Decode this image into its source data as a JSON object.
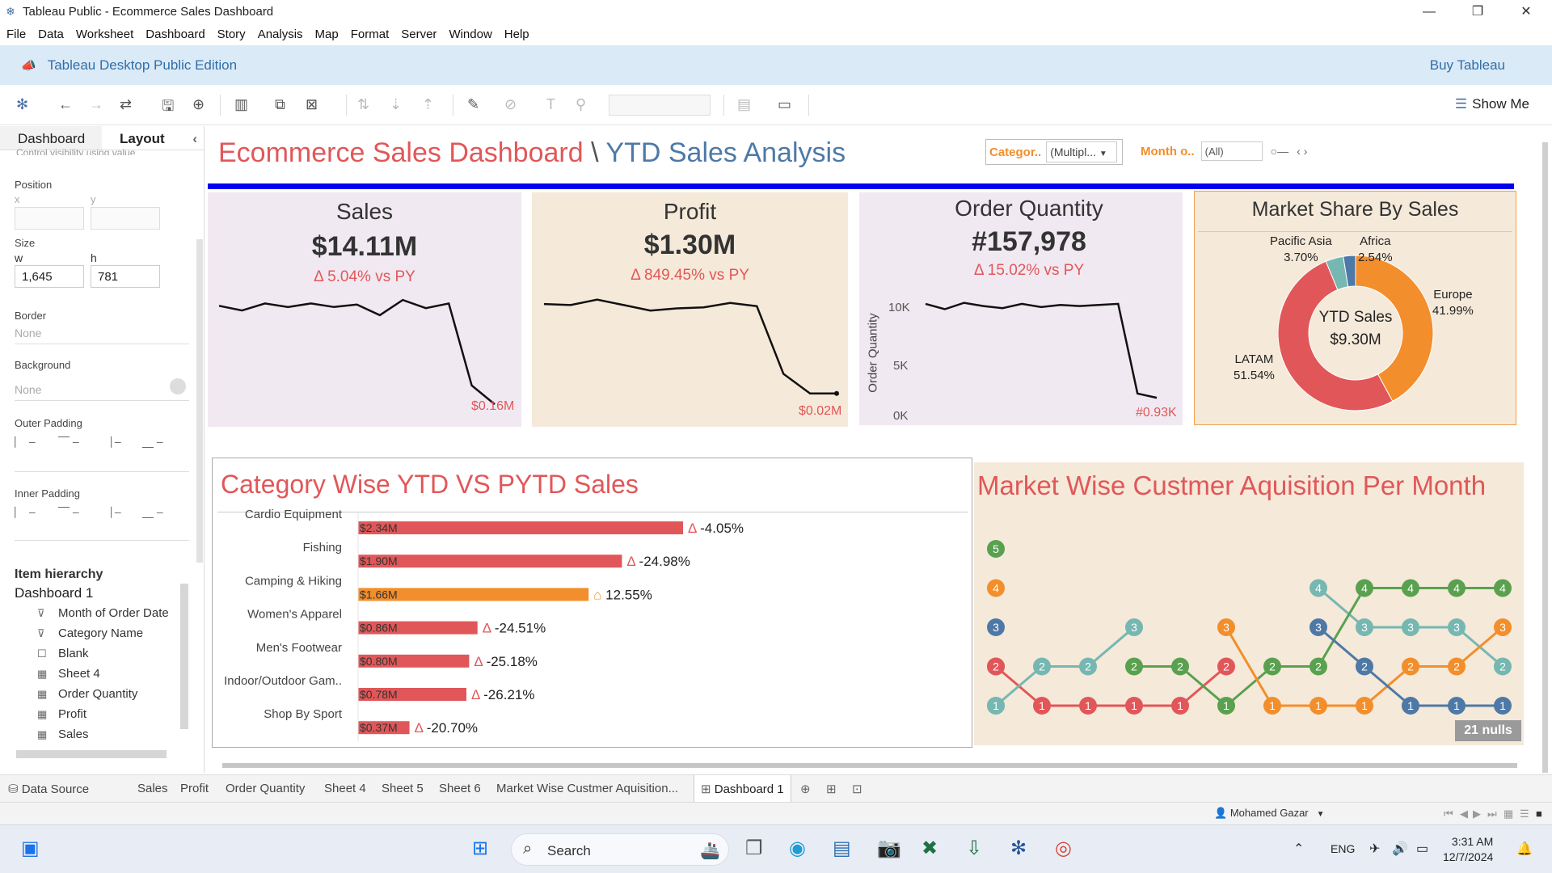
{
  "window": {
    "title": "Tableau Public - Ecommerce Sales Dashboard",
    "minimize": "—",
    "restore": "❐",
    "close": "✕"
  },
  "menu": [
    "File",
    "Data",
    "Worksheet",
    "Dashboard",
    "Story",
    "Analysis",
    "Map",
    "Format",
    "Server",
    "Window",
    "Help"
  ],
  "banner": {
    "edition": "Tableau Desktop Public Edition",
    "buy": "Buy Tableau"
  },
  "toolbar": {
    "show_me": "Show Me"
  },
  "left_pane": {
    "tabs": [
      "Dashboard",
      "Layout"
    ],
    "cut_text": "Control visibility using value",
    "position_label": "Position",
    "x_label": "x",
    "y_label": "y",
    "size_label": "Size",
    "w_label": "w",
    "h_label": "h",
    "w_value": "1,645",
    "h_value": "781",
    "border_label": "Border",
    "border_value": "None",
    "background_label": "Background",
    "background_value": "None",
    "outer_padding_label": "Outer Padding",
    "inner_padding_label": "Inner Padding",
    "hierarchy_title": "Item hierarchy",
    "hierarchy_root": "Dashboard 1",
    "hierarchy_items": [
      {
        "icon": "filter-icon",
        "glyph": "⊽",
        "label": "Month of Order Date"
      },
      {
        "icon": "filter-icon",
        "glyph": "⊽",
        "label": "Category Name"
      },
      {
        "icon": "blank-icon",
        "glyph": "☐",
        "label": "Blank"
      },
      {
        "icon": "sheet-icon",
        "glyph": "▦",
        "label": "Sheet 4"
      },
      {
        "icon": "sheet-icon",
        "glyph": "▦",
        "label": "Order Quantity"
      },
      {
        "icon": "sheet-icon",
        "glyph": "▦",
        "label": "Profit"
      },
      {
        "icon": "sheet-icon",
        "glyph": "▦",
        "label": "Sales"
      }
    ]
  },
  "dashboard": {
    "title_main": "Ecommerce Sales Dashboard",
    "title_sep": "\\",
    "title_sub": "YTD Sales Analysis",
    "filter_category_label": "Categor..",
    "filter_category_value": "(Multipl...",
    "filter_month_label": "Month o..",
    "filter_month_value": "(All)",
    "colors": {
      "red": "#e15759",
      "orange": "#f28e2b",
      "blue": "#4e79a7",
      "green": "#59a14f",
      "teal": "#76b7b2"
    }
  },
  "kpis": {
    "sales": {
      "title": "Sales",
      "value": "$14.11M",
      "delta": "Δ 5.04% vs PY",
      "end_label": "$0.16M",
      "line": [
        0.14,
        0.18,
        0.12,
        0.15,
        0.12,
        0.15,
        0.13,
        0.22,
        0.09,
        0.16,
        0.12,
        0.82,
        0.98
      ]
    },
    "profit": {
      "title": "Profit",
      "value": "$1.30M",
      "delta": "Δ 849.45% vs PY",
      "end_label": "$0.02M",
      "line": [
        0.06,
        0.07,
        0.02,
        0.07,
        0.12,
        0.1,
        0.09,
        0.05,
        0.08,
        0.7,
        0.88,
        0.88
      ]
    },
    "orders": {
      "title": "Order Quantity",
      "value": "#157,978",
      "delta": "Δ 15.02% vs PY",
      "end_label": "#0.93K",
      "y_axis_label": "Order Quantity",
      "y_ticks": [
        "10K",
        "5K",
        "0K"
      ],
      "line": [
        0.06,
        0.11,
        0.05,
        0.08,
        0.1,
        0.06,
        0.09,
        0.07,
        0.08,
        0.07,
        0.06,
        0.9,
        0.94
      ]
    }
  },
  "market_share": {
    "title": "Market Share By Sales",
    "center_label": "YTD Sales",
    "center_value": "$9.30M",
    "slices": [
      {
        "name": "Europe",
        "pct": "41.99%",
        "value": 41.99,
        "color": "#f28e2b"
      },
      {
        "name": "LATAM",
        "pct": "51.54%",
        "value": 51.54,
        "color": "#e15759"
      },
      {
        "name": "Pacific Asia",
        "pct": "3.70%",
        "value": 3.7,
        "color": "#76b7b2"
      },
      {
        "name": "Africa",
        "pct": "2.54%",
        "value": 2.54,
        "color": "#4e79a7"
      }
    ]
  },
  "chart_data": {
    "type": "bar",
    "title": "Category Wise YTD VS PYTD Sales",
    "categories": [
      "Cardio Equipment",
      "Fishing",
      "Camping & Hiking",
      "Women's Apparel",
      "Men's Footwear",
      "Indoor/Outdoor Gam..",
      "Shop By Sport"
    ],
    "values": [
      2.34,
      1.9,
      1.66,
      0.86,
      0.8,
      0.78,
      0.37
    ],
    "value_labels": [
      "$2.34M",
      "$1.90M",
      "$1.66M",
      "$0.86M",
      "$0.80M",
      "$0.78M",
      "$0.37M"
    ],
    "deltas": [
      "Δ -4.05%",
      "Δ -24.98%",
      "⌂ 12.55%",
      "Δ -24.51%",
      "Δ -25.18%",
      "Δ -26.21%",
      "Δ -20.70%"
    ],
    "colors": [
      "#e15759",
      "#e15759",
      "#f28e2b",
      "#e15759",
      "#e15759",
      "#e15759",
      "#e15759"
    ]
  },
  "acquisition": {
    "title": "Market Wise Custmer Aquisition Per Month",
    "nulls": "21 nulls",
    "legend_ranks": [
      {
        "rank": 5,
        "color": "#59a14f"
      },
      {
        "rank": 4,
        "color": "#f28e2b"
      },
      {
        "rank": 3,
        "color": "#4e79a7"
      },
      {
        "rank": 2,
        "color": "#e15759"
      },
      {
        "rank": 1,
        "color": "#76b7b2"
      }
    ],
    "series": [
      {
        "name": "red",
        "color": "#e15759",
        "ranks": [
          2,
          1,
          1,
          1,
          1,
          2,
          null,
          null,
          null,
          null,
          null,
          null
        ]
      },
      {
        "name": "teal",
        "color": "#76b7b2",
        "ranks": [
          1,
          2,
          2,
          3,
          null,
          null,
          null,
          4,
          3,
          3,
          3,
          2
        ]
      },
      {
        "name": "green",
        "color": "#59a14f",
        "ranks": [
          null,
          null,
          null,
          2,
          2,
          1,
          2,
          2,
          4,
          4,
          4,
          4
        ]
      },
      {
        "name": "orange",
        "color": "#f28e2b",
        "ranks": [
          null,
          null,
          null,
          null,
          null,
          3,
          1,
          1,
          1,
          2,
          2,
          3
        ]
      },
      {
        "name": "blue",
        "color": "#4e79a7",
        "ranks": [
          null,
          null,
          null,
          null,
          null,
          null,
          null,
          3,
          2,
          1,
          1,
          1
        ]
      }
    ]
  },
  "sheet_tabs": [
    "Data Source",
    "Sales",
    "Profit",
    "Order Quantity",
    "Sheet 4",
    "Sheet 5",
    "Sheet 6",
    "Market Wise Custmer Aquisition...",
    "Dashboard 1"
  ],
  "status": {
    "user": "Mohamed Gazar"
  },
  "taskbar": {
    "search": "Search",
    "lang": "ENG",
    "time": "3:31 AM",
    "date": "12/7/2024"
  }
}
